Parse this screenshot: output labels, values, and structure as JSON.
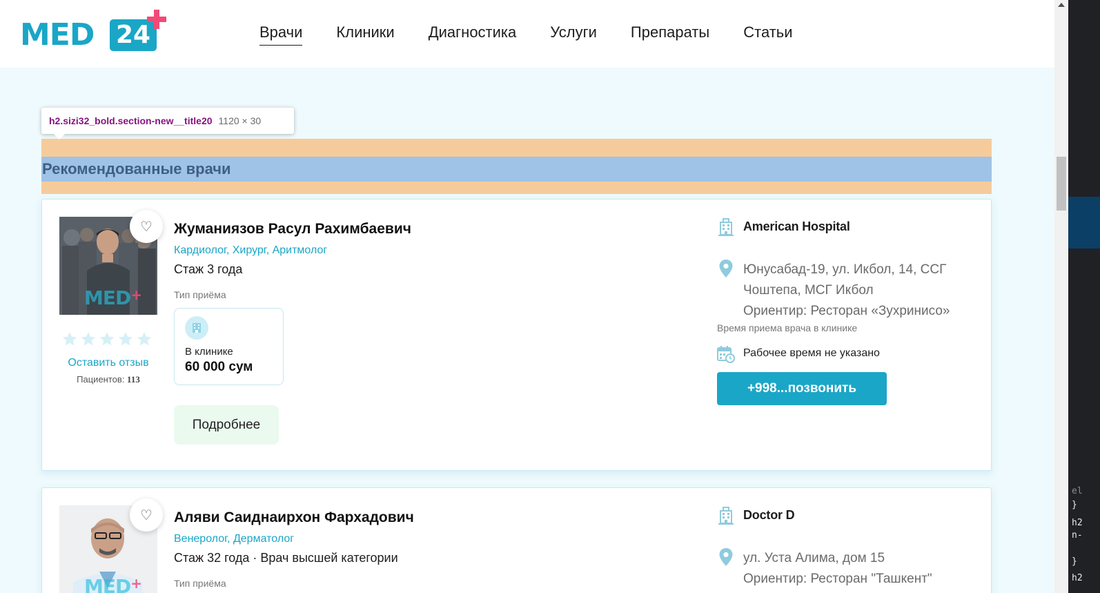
{
  "logo": {
    "text": "MED",
    "number": "24"
  },
  "nav": {
    "items": [
      {
        "label": "Врачи",
        "active": true
      },
      {
        "label": "Клиники"
      },
      {
        "label": "Диагностика"
      },
      {
        "label": "Услуги"
      },
      {
        "label": "Препараты"
      },
      {
        "label": "Статьи"
      }
    ]
  },
  "inspector_tooltip": {
    "selector": "h2.sizi32_bold.section-new__title20",
    "size": "1120 × 30"
  },
  "section": {
    "title": "Рекомендованные врачи"
  },
  "doctors": [
    {
      "name": "Жуманиязов Расул Рахимбаевич",
      "specialties": "Кардиолог, Хирург, Аритмолог",
      "experience": "Стаж 3 года",
      "reception_type_label": "Тип приёма",
      "reception_where": "В клинике",
      "price": "60 000 сум",
      "rating": 0,
      "review_link": "Оставить отзыв",
      "patients_label": "Пациентов:",
      "patients_count": "113",
      "more_label": "Подробнее",
      "clinic": "American Hospital",
      "address": "Юнусабад-19, ул. Икбол, 14, ССГ Чоштепа, МСГ Икбол",
      "landmark": "Ориентир: Ресторан «Зухринисо»",
      "hours_label": "Время приема врача в клинике",
      "hours": "Рабочее время не указано",
      "call_label": "+998...позвонить",
      "photo_watermark": "MED"
    },
    {
      "name": "Аляви Саиднаирхон Фархадович",
      "specialties": "Венеролог, Дерматолог",
      "experience": "Стаж 32 года · Врач высшей категории",
      "reception_type_label": "Тип приёма",
      "clinic": "Doctor D",
      "address": "ул. Уста Алима, дом 15",
      "landmark": "Ориентир: Ресторан \"Ташкент\"",
      "photo_watermark": "MED"
    }
  ],
  "colors": {
    "brand": "#1aa6c7",
    "brand_plus": "#f24a78",
    "highlight_margin": "#f6cb9b",
    "highlight_content": "#9fc3e6"
  },
  "devtools": {
    "lines": [
      "el",
      "}",
      "h2",
      "n-",
      "}",
      "h2"
    ]
  }
}
